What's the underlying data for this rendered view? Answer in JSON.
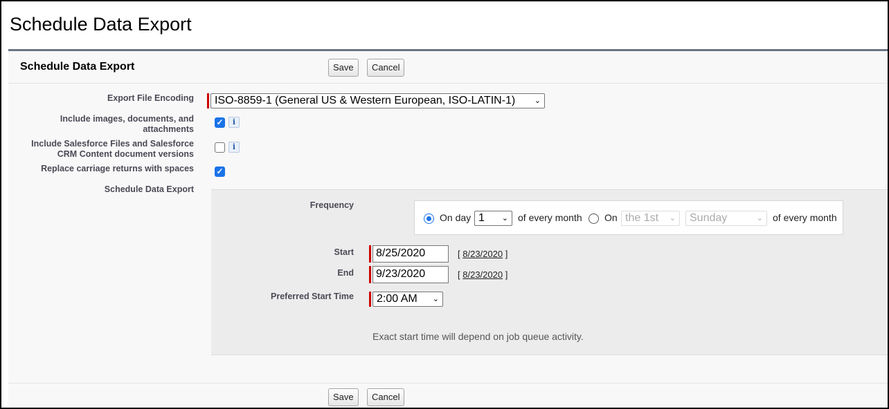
{
  "page": {
    "title": "Schedule Data Export"
  },
  "panel": {
    "title": "Schedule Data Export"
  },
  "buttons": {
    "save": "Save",
    "cancel": "Cancel"
  },
  "fields": {
    "encoding": {
      "label": "Export File Encoding",
      "value": "ISO-8859-1 (General US & Western European, ISO-LATIN-1)"
    },
    "include_images": {
      "label_line1": "Include images, documents, and",
      "label_line2": "attachments",
      "checked": true
    },
    "include_files": {
      "label_line1": "Include Salesforce Files and Salesforce",
      "label_line2": "CRM Content document versions",
      "checked": false
    },
    "replace_cr": {
      "label": "Replace carriage returns with spaces",
      "checked": true
    },
    "schedule_label": "Schedule Data Export"
  },
  "schedule": {
    "frequency_label": "Frequency",
    "option1_prefix": "On day",
    "day_value": "1",
    "option1_suffix": "of every month",
    "option2_prefix": "On",
    "ordinal_value": "the 1st",
    "weekday_value": "Sunday",
    "option2_suffix": "of every month",
    "start_label": "Start",
    "start_value": "8/25/2020",
    "start_today": "8/23/2020",
    "end_label": "End",
    "end_value": "9/23/2020",
    "end_today": "8/23/2020",
    "time_label": "Preferred Start Time",
    "time_value": "2:00 AM",
    "note": "Exact start time will depend on job queue activity."
  },
  "glyphs": {
    "check": "✓",
    "info": "i",
    "chevron": "⌄",
    "bracket_open": "[",
    "bracket_close": "]"
  }
}
